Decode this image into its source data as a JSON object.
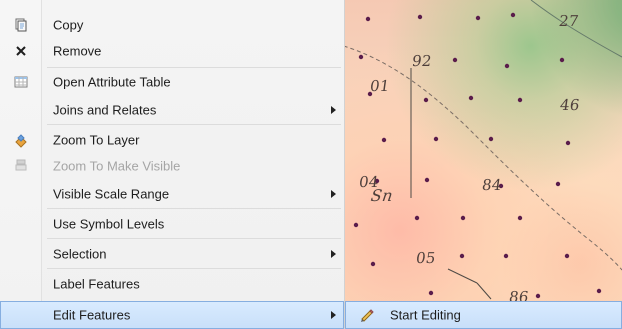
{
  "menu": {
    "items": [
      {
        "label": "Copy",
        "icon": "copy-icon",
        "enabled": true,
        "submenu": false
      },
      {
        "label": "Remove",
        "icon": "remove-icon",
        "enabled": true,
        "submenu": false
      },
      {
        "label": "Open Attribute Table",
        "icon": "attribute-table-icon",
        "enabled": true,
        "submenu": false
      },
      {
        "label": "Joins and Relates",
        "icon": "",
        "enabled": true,
        "submenu": true
      },
      {
        "label": "Zoom To Layer",
        "icon": "zoom-to-layer-icon",
        "enabled": true,
        "submenu": false
      },
      {
        "label": "Zoom To Make Visible",
        "icon": "zoom-to-make-visible-icon",
        "enabled": false,
        "submenu": false
      },
      {
        "label": "Visible Scale Range",
        "icon": "",
        "enabled": true,
        "submenu": true
      },
      {
        "label": "Use Symbol Levels",
        "icon": "",
        "enabled": true,
        "submenu": false
      },
      {
        "label": "Selection",
        "icon": "",
        "enabled": true,
        "submenu": true
      },
      {
        "label": "Label Features",
        "icon": "",
        "enabled": true,
        "submenu": false
      },
      {
        "label": "Edit Features",
        "icon": "",
        "enabled": true,
        "submenu": true,
        "highlighted": true
      }
    ],
    "submenu": {
      "items": [
        {
          "label": "Start Editing",
          "icon": "pencil-icon"
        }
      ]
    }
  },
  "map": {
    "labels": [
      {
        "text": "27"
      },
      {
        "text": "92"
      },
      {
        "text": "01"
      },
      {
        "text": "46"
      },
      {
        "text": "04"
      },
      {
        "text": "Sn"
      },
      {
        "text": "84"
      },
      {
        "text": "05"
      },
      {
        "text": "86"
      }
    ]
  },
  "colors": {
    "menu_background": "#f0f0f0",
    "menu_highlight": "#cfe5ff",
    "menu_highlight_border": "#86aee0",
    "menu_disabled_text": "#a5a5a5",
    "map_accent_green": "#84c08a",
    "map_accent_pink": "#ffb8a9",
    "map_point": "#5a1c4b"
  }
}
